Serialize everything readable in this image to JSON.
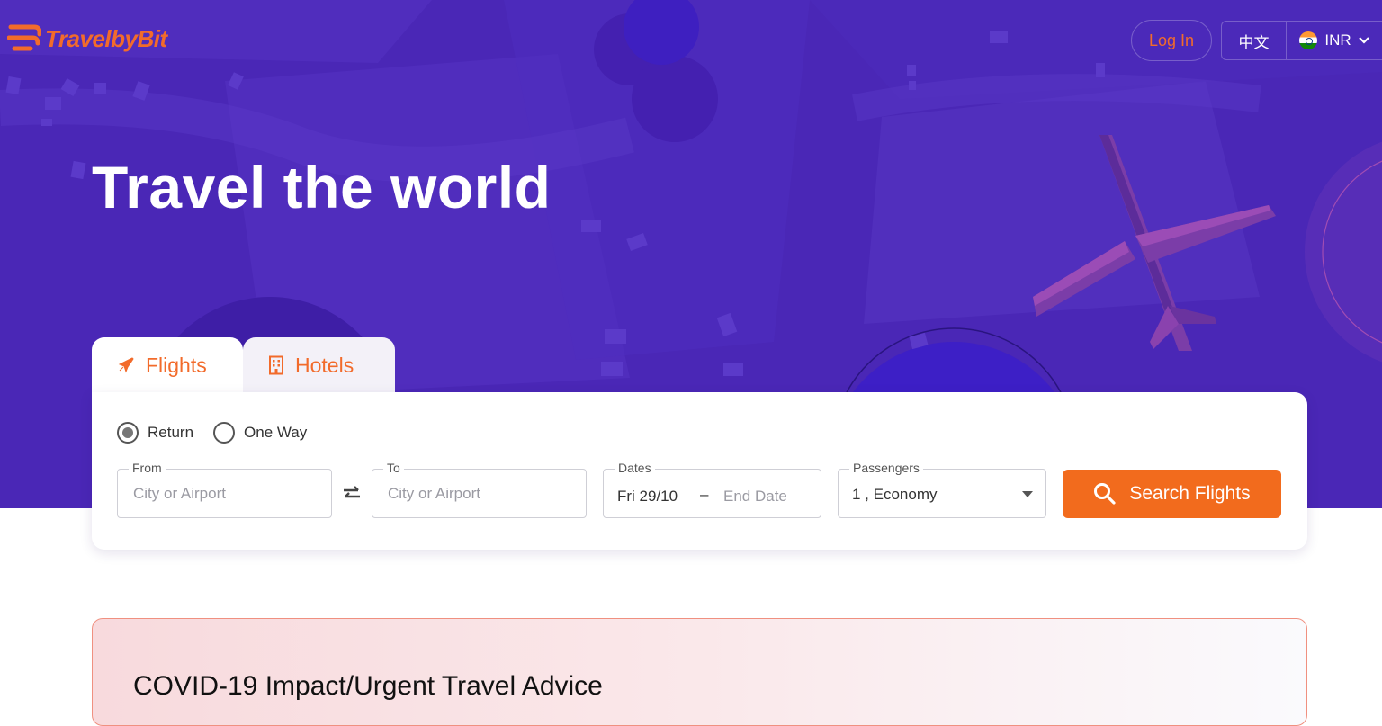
{
  "brand": {
    "name": "TravelbyBit",
    "color": "#f26b2b"
  },
  "nav": {
    "login_label": "Log In",
    "language_label": "中文",
    "currency_label": "INR",
    "currency_flag": "india-flag-icon"
  },
  "hero": {
    "title": "Travel the world",
    "bg_color": "#4a28b8"
  },
  "tabs": [
    {
      "label": "Flights",
      "icon": "plane-icon",
      "active": true
    },
    {
      "label": "Hotels",
      "icon": "building-icon",
      "active": false
    }
  ],
  "trip_types": [
    {
      "label": "Return",
      "checked": true
    },
    {
      "label": "One Way",
      "checked": false
    }
  ],
  "search": {
    "from": {
      "label": "From",
      "placeholder": "City or Airport"
    },
    "to": {
      "label": "To",
      "placeholder": "City or Airport"
    },
    "dates": {
      "label": "Dates",
      "start": "Fri 29/10",
      "separator": "–",
      "end_placeholder": "End Date"
    },
    "passengers": {
      "label": "Passengers",
      "value": "1 , Economy"
    },
    "button_label": "Search Flights",
    "button_color": "#f26b1d"
  },
  "covid": {
    "title": "COVID-19 Impact/Urgent Travel Advice"
  }
}
